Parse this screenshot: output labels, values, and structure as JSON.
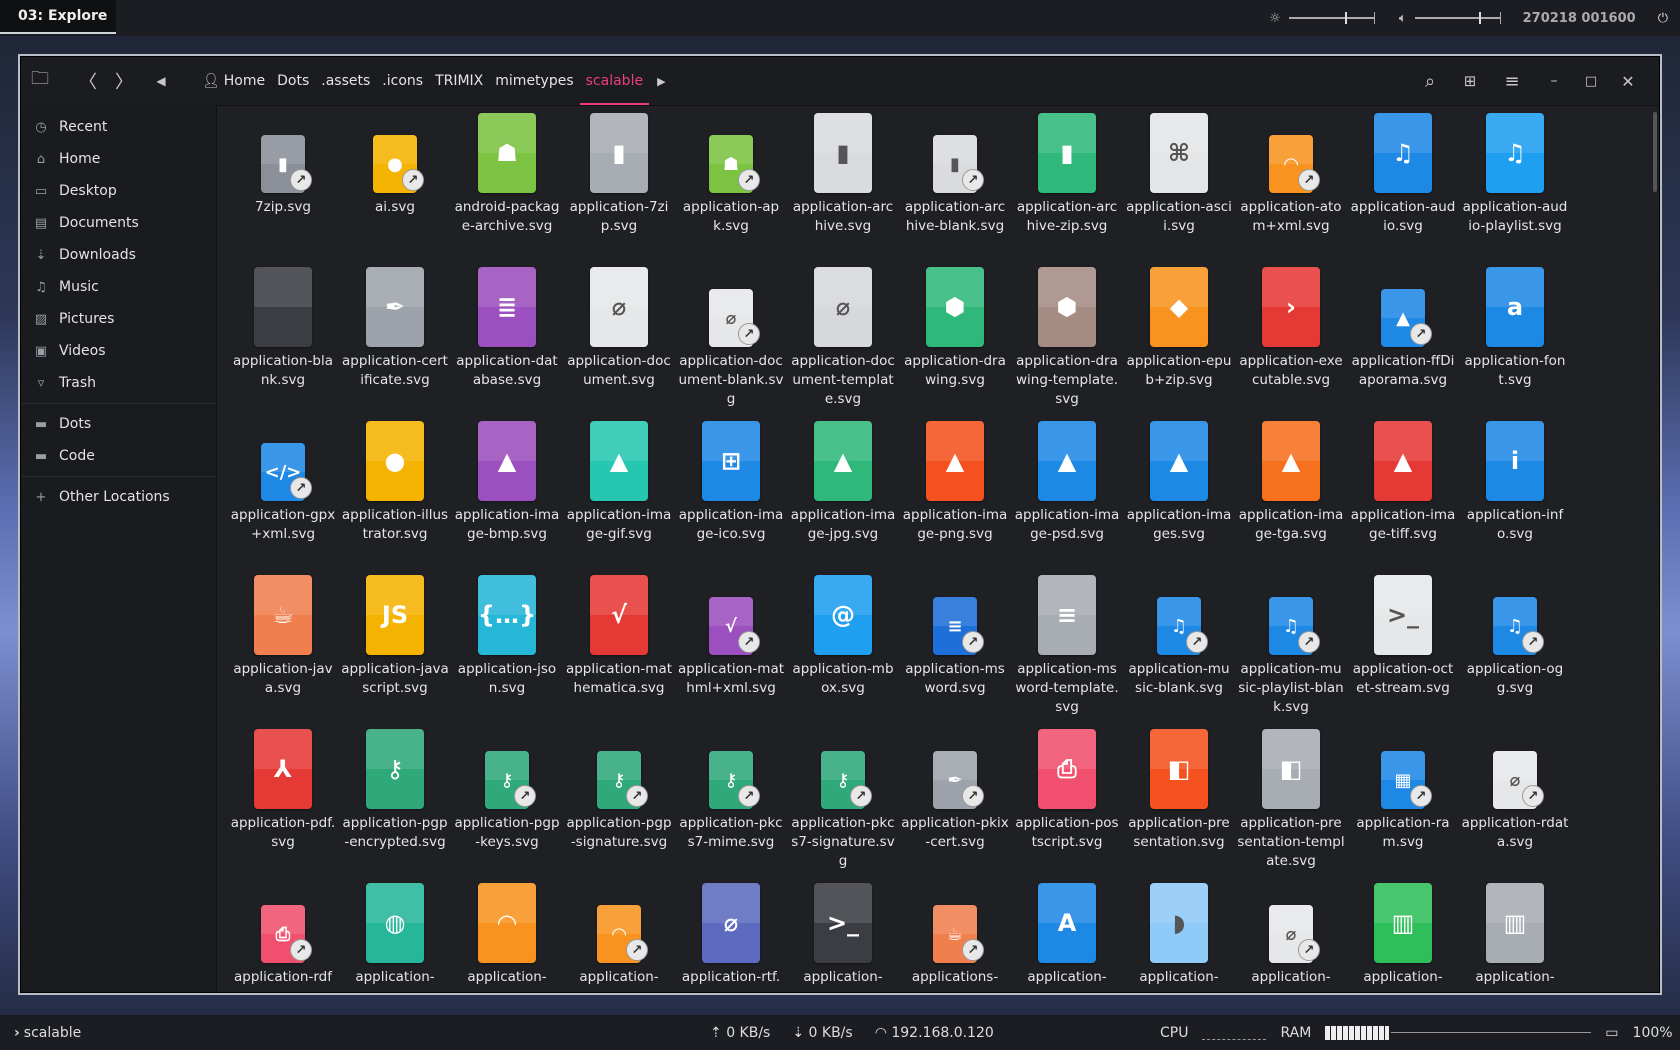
{
  "topbar": {
    "workspace": "03: Explore",
    "datetime": "270218 001600"
  },
  "window": {
    "breadcrumbs": [
      "Home",
      "Dots",
      ".assets",
      ".icons",
      "TRIMIX",
      "mimetypes",
      "scalable"
    ],
    "active_crumb": "scalable"
  },
  "sidebar": {
    "items": [
      {
        "label": "Recent",
        "icon": "clock-icon"
      },
      {
        "label": "Home",
        "icon": "home-icon"
      },
      {
        "label": "Desktop",
        "icon": "desktop-icon"
      },
      {
        "label": "Documents",
        "icon": "documents-icon"
      },
      {
        "label": "Downloads",
        "icon": "download-icon"
      },
      {
        "label": "Music",
        "icon": "music-icon"
      },
      {
        "label": "Pictures",
        "icon": "pictures-icon"
      },
      {
        "label": "Videos",
        "icon": "videos-icon"
      },
      {
        "label": "Trash",
        "icon": "trash-icon"
      }
    ],
    "bookmarks": [
      {
        "label": "Dots",
        "icon": "folder-icon"
      },
      {
        "label": "Code",
        "icon": "folder-icon"
      }
    ],
    "other": "Other Locations"
  },
  "files": [
    {
      "name": "7zip.svg",
      "color": "#8a8f98",
      "glyph": "▮",
      "small": true,
      "link": true
    },
    {
      "name": "ai.svg",
      "color": "#f5b301",
      "glyph": "●",
      "small": true,
      "link": true
    },
    {
      "name": "android-package-archive.svg",
      "color": "#7cc341",
      "glyph": "☗",
      "small": false,
      "link": false
    },
    {
      "name": "application-7zip.svg",
      "color": "#a8acb3",
      "glyph": "▮",
      "small": false,
      "link": false
    },
    {
      "name": "application-apk.svg",
      "color": "#7cc341",
      "glyph": "☗",
      "small": true,
      "link": true
    },
    {
      "name": "application-archive.svg",
      "color": "#d9dbde",
      "glyph": "▮",
      "small": false,
      "link": false
    },
    {
      "name": "application-archive-blank.svg",
      "color": "#d9dbde",
      "glyph": "▮",
      "small": true,
      "link": true
    },
    {
      "name": "application-archive-zip.svg",
      "color": "#2fb87a",
      "glyph": "▮",
      "small": false,
      "link": false
    },
    {
      "name": "application-ascii.svg",
      "color": "#e4e5e7",
      "glyph": "⌘",
      "small": false,
      "link": false
    },
    {
      "name": "application-atom+xml.svg",
      "color": "#f7931e",
      "glyph": "◠",
      "small": true,
      "link": true
    },
    {
      "name": "application-audio.svg",
      "color": "#1e88e5",
      "glyph": "♫",
      "small": false,
      "link": false
    },
    {
      "name": "application-audio-playlist.svg",
      "color": "#1e9ff0",
      "glyph": "♫",
      "small": false,
      "link": false
    },
    {
      "name": "application-blank.svg",
      "color": "#3b3d42",
      "glyph": "",
      "small": false,
      "link": false
    },
    {
      "name": "application-certificate.svg",
      "color": "#9ea3ab",
      "glyph": "✒",
      "small": false,
      "link": false
    },
    {
      "name": "application-database.svg",
      "color": "#9c4fbe",
      "glyph": "≣",
      "small": false,
      "link": false
    },
    {
      "name": "application-document.svg",
      "color": "#e6e7e9",
      "glyph": "⌀",
      "small": false,
      "link": false
    },
    {
      "name": "application-document-blank.svg",
      "color": "#e6e7e9",
      "glyph": "⌀",
      "small": true,
      "link": true
    },
    {
      "name": "application-document-template.svg",
      "color": "#d7d8db",
      "glyph": "⌀",
      "small": false,
      "link": false
    },
    {
      "name": "application-drawing.svg",
      "color": "#2fb87a",
      "glyph": "⬢",
      "small": false,
      "link": false
    },
    {
      "name": "application-drawing-template.svg",
      "color": "#a68b83",
      "glyph": "⬢",
      "small": false,
      "link": false
    },
    {
      "name": "application-epub+zip.svg",
      "color": "#f7931e",
      "glyph": "◆",
      "small": false,
      "link": false
    },
    {
      "name": "application-executable.svg",
      "color": "#e53935",
      "glyph": "›",
      "small": false,
      "link": false
    },
    {
      "name": "application-ffDiaporama.svg",
      "color": "#1e88e5",
      "glyph": "▲",
      "small": true,
      "link": true
    },
    {
      "name": "application-font.svg",
      "color": "#1e88e5",
      "glyph": "a",
      "small": false,
      "link": false
    },
    {
      "name": "application-gpx+xml.svg",
      "color": "#1e88e5",
      "glyph": "</>",
      "small": true,
      "link": true
    },
    {
      "name": "application-illustrator.svg",
      "color": "#f5b301",
      "glyph": "●",
      "small": false,
      "link": false
    },
    {
      "name": "application-image-bmp.svg",
      "color": "#9c4fbe",
      "glyph": "▲",
      "small": false,
      "link": false
    },
    {
      "name": "application-image-gif.svg",
      "color": "#26c6b0",
      "glyph": "▲",
      "small": false,
      "link": false
    },
    {
      "name": "application-image-ico.svg",
      "color": "#1e88e5",
      "glyph": "⊞",
      "small": false,
      "link": false
    },
    {
      "name": "application-image-jpg.svg",
      "color": "#2fb87a",
      "glyph": "▲",
      "small": false,
      "link": false
    },
    {
      "name": "application-image-png.svg",
      "color": "#f4511e",
      "glyph": "▲",
      "small": false,
      "link": false
    },
    {
      "name": "application-image-psd.svg",
      "color": "#1e88e5",
      "glyph": "▲",
      "small": false,
      "link": false
    },
    {
      "name": "application-images.svg",
      "color": "#1e88e5",
      "glyph": "▲",
      "small": false,
      "link": false
    },
    {
      "name": "application-image-tga.svg",
      "color": "#f7701e",
      "glyph": "▲",
      "small": false,
      "link": false
    },
    {
      "name": "application-image-tiff.svg",
      "color": "#e53935",
      "glyph": "▲",
      "small": false,
      "link": false
    },
    {
      "name": "application-info.svg",
      "color": "#1e88e5",
      "glyph": "i",
      "small": false,
      "link": false
    },
    {
      "name": "application-java.svg",
      "color": "#f07f4e",
      "glyph": "☕",
      "small": false,
      "link": false
    },
    {
      "name": "application-javascript.svg",
      "color": "#f5b301",
      "glyph": "JS",
      "small": false,
      "link": false
    },
    {
      "name": "application-json.svg",
      "color": "#26b6d8",
      "glyph": "{…}",
      "small": false,
      "link": false
    },
    {
      "name": "application-mathematica.svg",
      "color": "#e53935",
      "glyph": "√",
      "small": false,
      "link": false
    },
    {
      "name": "application-mathml+xml.svg",
      "color": "#9c4fbe",
      "glyph": "√",
      "small": true,
      "link": true
    },
    {
      "name": "application-mbox.svg",
      "color": "#1e9ff0",
      "glyph": "@",
      "small": false,
      "link": false
    },
    {
      "name": "application-msword.svg",
      "color": "#1e6fd8",
      "glyph": "≡",
      "small": true,
      "link": true
    },
    {
      "name": "application-msword-template.svg",
      "color": "#a8acb3",
      "glyph": "≡",
      "small": false,
      "link": false
    },
    {
      "name": "application-music-blank.svg",
      "color": "#1e88e5",
      "glyph": "♫",
      "small": true,
      "link": true
    },
    {
      "name": "application-music-playlist-blank.svg",
      "color": "#1e88e5",
      "glyph": "♫",
      "small": true,
      "link": true
    },
    {
      "name": "application-octet-stream.svg",
      "color": "#e6e7e9",
      "glyph": ">_",
      "small": false,
      "link": false
    },
    {
      "name": "application-ogg.svg",
      "color": "#1e88e5",
      "glyph": "♫",
      "small": true,
      "link": true
    },
    {
      "name": "application-pdf.svg",
      "color": "#e53935",
      "glyph": "⅄",
      "small": false,
      "link": false
    },
    {
      "name": "application-pgp-encrypted.svg",
      "color": "#2fa87a",
      "glyph": "⚷",
      "small": false,
      "link": false
    },
    {
      "name": "application-pgp-keys.svg",
      "color": "#2fa87a",
      "glyph": "⚷",
      "small": true,
      "link": true
    },
    {
      "name": "application-pgp-signature.svg",
      "color": "#2fa87a",
      "glyph": "⚷",
      "small": true,
      "link": true
    },
    {
      "name": "application-pkcs7-mime.svg",
      "color": "#2fa87a",
      "glyph": "⚷",
      "small": true,
      "link": true
    },
    {
      "name": "application-pkcs7-signature.svg",
      "color": "#2fa87a",
      "glyph": "⚷",
      "small": true,
      "link": true
    },
    {
      "name": "application-pkix-cert.svg",
      "color": "#9ea3ab",
      "glyph": "✒",
      "small": true,
      "link": true
    },
    {
      "name": "application-postscript.svg",
      "color": "#f0506e",
      "glyph": "⎙",
      "small": false,
      "link": false
    },
    {
      "name": "application-presentation.svg",
      "color": "#f4511e",
      "glyph": "◧",
      "small": false,
      "link": false
    },
    {
      "name": "application-presentation-template.svg",
      "color": "#a8acb3",
      "glyph": "◧",
      "small": false,
      "link": false
    },
    {
      "name": "application-ram.svg",
      "color": "#1e88e5",
      "glyph": "▦",
      "small": true,
      "link": true
    },
    {
      "name": "application-rdata.svg",
      "color": "#e6e7e9",
      "glyph": "⌀",
      "small": true,
      "link": true
    },
    {
      "name": "application-rdf",
      "color": "#f0506e",
      "glyph": "⎙",
      "small": true,
      "link": true
    },
    {
      "name": "application-",
      "color": "#26b69a",
      "glyph": "◍",
      "small": false,
      "link": false
    },
    {
      "name": "application-",
      "color": "#f7931e",
      "glyph": "◠",
      "small": false,
      "link": false
    },
    {
      "name": "application-",
      "color": "#f7931e",
      "glyph": "◠",
      "small": true,
      "link": true
    },
    {
      "name": "application-rtf.",
      "color": "#5c6bc0",
      "glyph": "⌀",
      "small": false,
      "link": false
    },
    {
      "name": "application-",
      "color": "#3b3d42",
      "glyph": ">_",
      "small": false,
      "link": false
    },
    {
      "name": "applications-",
      "color": "#f07f4e",
      "glyph": "☕",
      "small": true,
      "link": true
    },
    {
      "name": "application-",
      "color": "#1e88e5",
      "glyph": "A",
      "small": false,
      "link": false
    },
    {
      "name": "application-",
      "color": "#90caf9",
      "glyph": "◗",
      "small": false,
      "link": false
    },
    {
      "name": "application-",
      "color": "#e6e7e9",
      "glyph": "⌀",
      "small": true,
      "link": true
    },
    {
      "name": "application-",
      "color": "#2fbf5a",
      "glyph": "▥",
      "small": false,
      "link": false
    },
    {
      "name": "application-",
      "color": "#a8acb3",
      "glyph": "▥",
      "small": false,
      "link": false
    }
  ],
  "bottombar": {
    "path": "scalable",
    "up_speed": "0 KB/s",
    "down_speed": "0 KB/s",
    "ip": "192.168.0.120",
    "cpu_label": "CPU",
    "ram_label": "RAM",
    "battery": "100%"
  }
}
